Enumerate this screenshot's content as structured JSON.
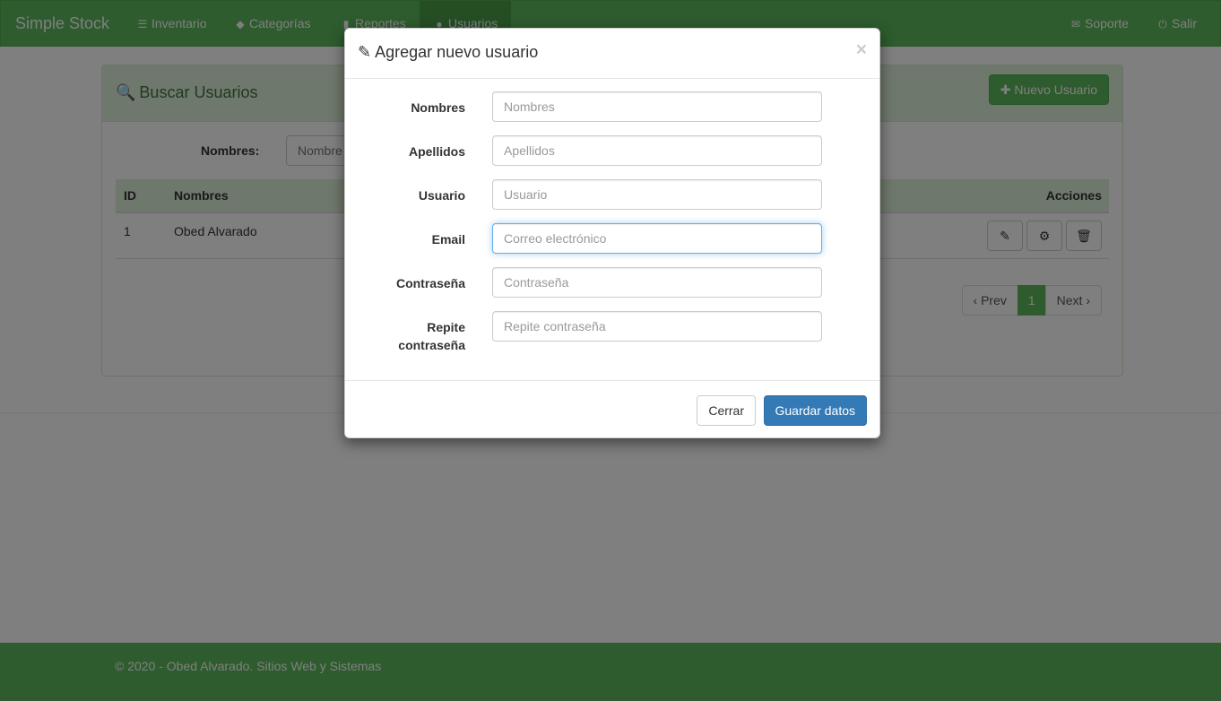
{
  "navbar": {
    "brand": "Simple Stock",
    "items": [
      {
        "label": "Inventario",
        "icon": "barcode-icon"
      },
      {
        "label": "Categorías",
        "icon": "tags-icon"
      },
      {
        "label": "Reportes",
        "icon": "signal-icon"
      },
      {
        "label": "Usuarios",
        "icon": "user-icon"
      }
    ],
    "right": [
      {
        "label": "Soporte",
        "icon": "envelope-icon"
      },
      {
        "label": "Salir",
        "icon": "power-icon"
      }
    ]
  },
  "panel": {
    "title": "Buscar Usuarios",
    "new_button": "Nuevo Usuario",
    "search": {
      "label": "Nombres:",
      "placeholder": "Nombre"
    },
    "table": {
      "columns": [
        "ID",
        "Nombres",
        "Acciones"
      ],
      "rows": [
        {
          "id": "1",
          "name": "Obed Alvarado"
        }
      ]
    },
    "pagination": {
      "prev": "‹ Prev",
      "current": "1",
      "next": "Next ›"
    }
  },
  "modal": {
    "title": "Agregar nuevo usuario",
    "close_symbol": "×",
    "fields": [
      {
        "label": "Nombres",
        "placeholder": "Nombres"
      },
      {
        "label": "Apellidos",
        "placeholder": "Apellidos"
      },
      {
        "label": "Usuario",
        "placeholder": "Usuario"
      },
      {
        "label": "Email",
        "placeholder": "Correo electrónico"
      },
      {
        "label": "Contraseña",
        "placeholder": "Contraseña"
      },
      {
        "label": "Repite contraseña",
        "placeholder": "Repite contraseña"
      }
    ],
    "buttons": {
      "close": "Cerrar",
      "save": "Guardar datos"
    }
  },
  "footer": {
    "text": "© 2020 - Obed Alvarado. Sitios Web y Sistemas"
  },
  "colors": {
    "brand_green": "#5cb85c",
    "primary_blue": "#337ab7"
  }
}
